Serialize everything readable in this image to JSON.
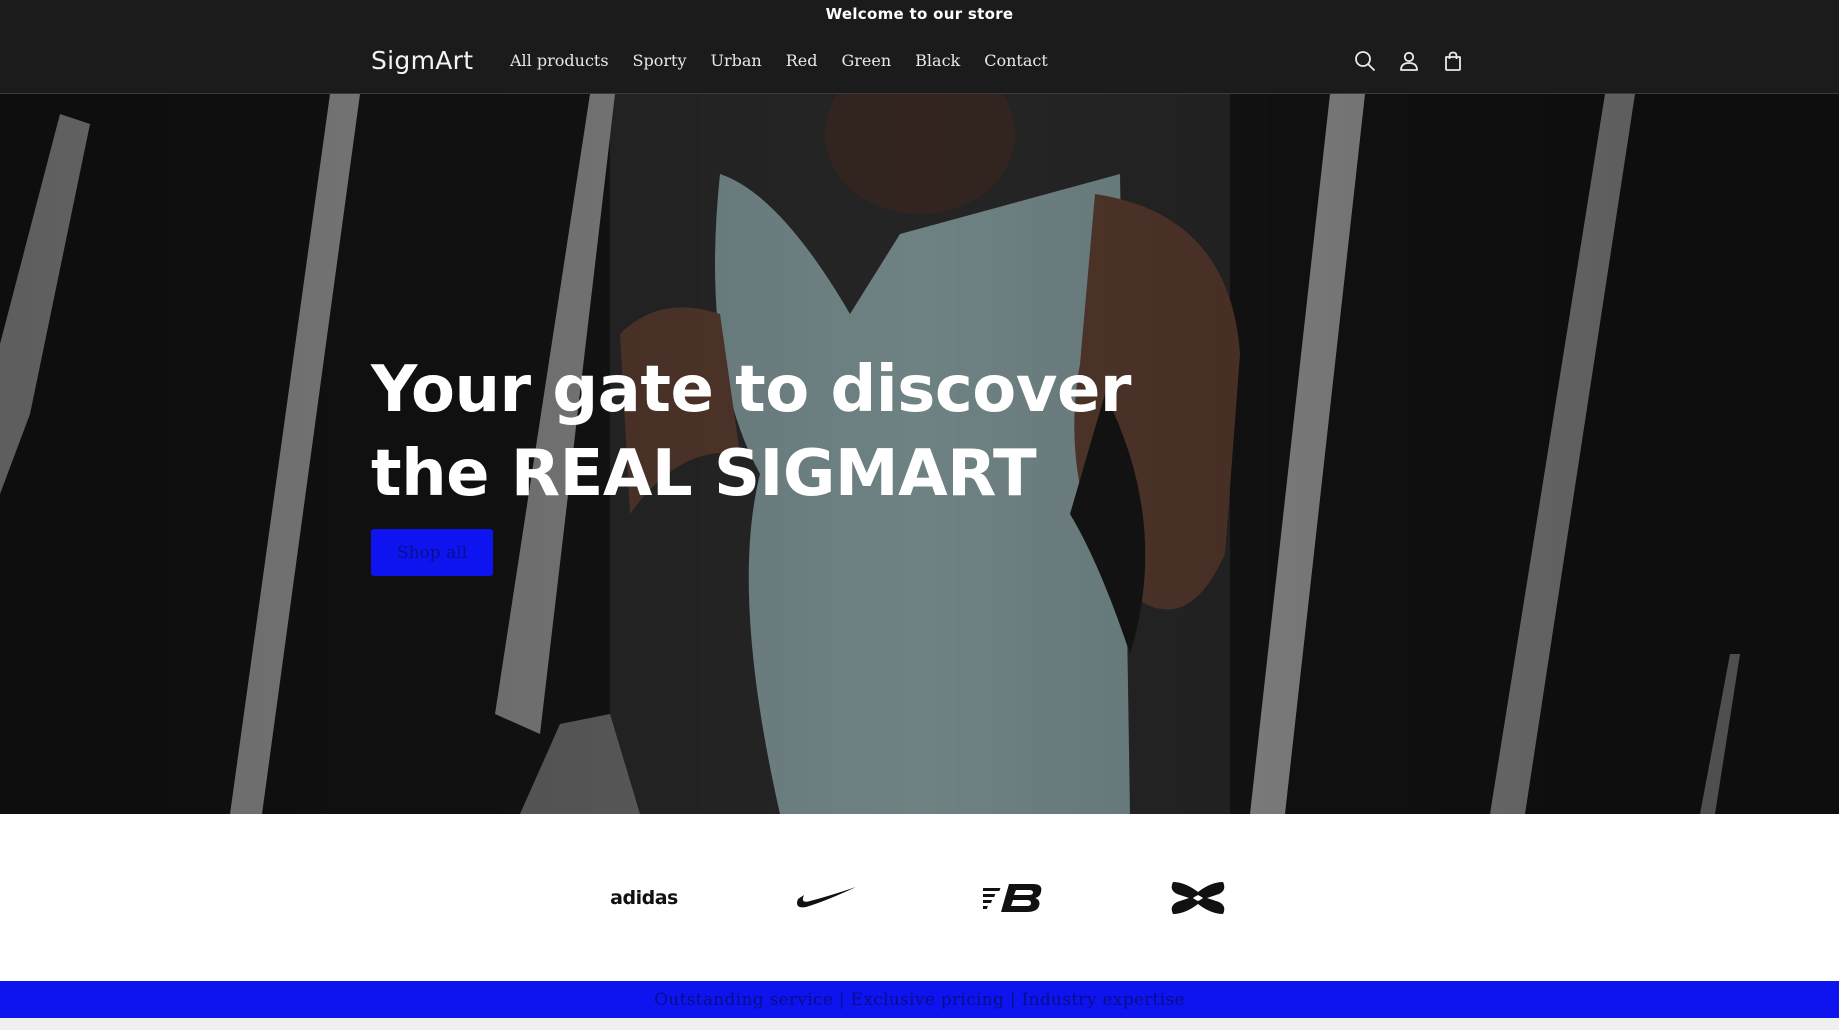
{
  "announcement": {
    "text": "Welcome to our store"
  },
  "header": {
    "logo": "SigmArt",
    "nav": [
      {
        "label": "All products"
      },
      {
        "label": "Sporty"
      },
      {
        "label": "Urban"
      },
      {
        "label": "Red"
      },
      {
        "label": "Green"
      },
      {
        "label": "Black"
      },
      {
        "label": "Contact"
      }
    ],
    "icons": [
      "search-icon",
      "account-icon",
      "cart-icon"
    ]
  },
  "hero": {
    "title": "Your gate to discover the REAL SIGMART",
    "button_label": "Shop all"
  },
  "brands": {
    "items": [
      {
        "name": "adidas",
        "wordmark": "adidas"
      },
      {
        "name": "nike",
        "icon": "nike-swoosh-logo"
      },
      {
        "name": "new-balance",
        "icon": "new-balance-logo"
      },
      {
        "name": "under-armour",
        "icon": "under-armour-logo"
      }
    ]
  },
  "usp_bar": {
    "text": "Outstanding service | Exclusive pricing | Industry expertise"
  },
  "colors": {
    "header_bg": "#1b1b1b",
    "accent_blue": "#0d14f0",
    "accent_text": "#0a0e86"
  }
}
